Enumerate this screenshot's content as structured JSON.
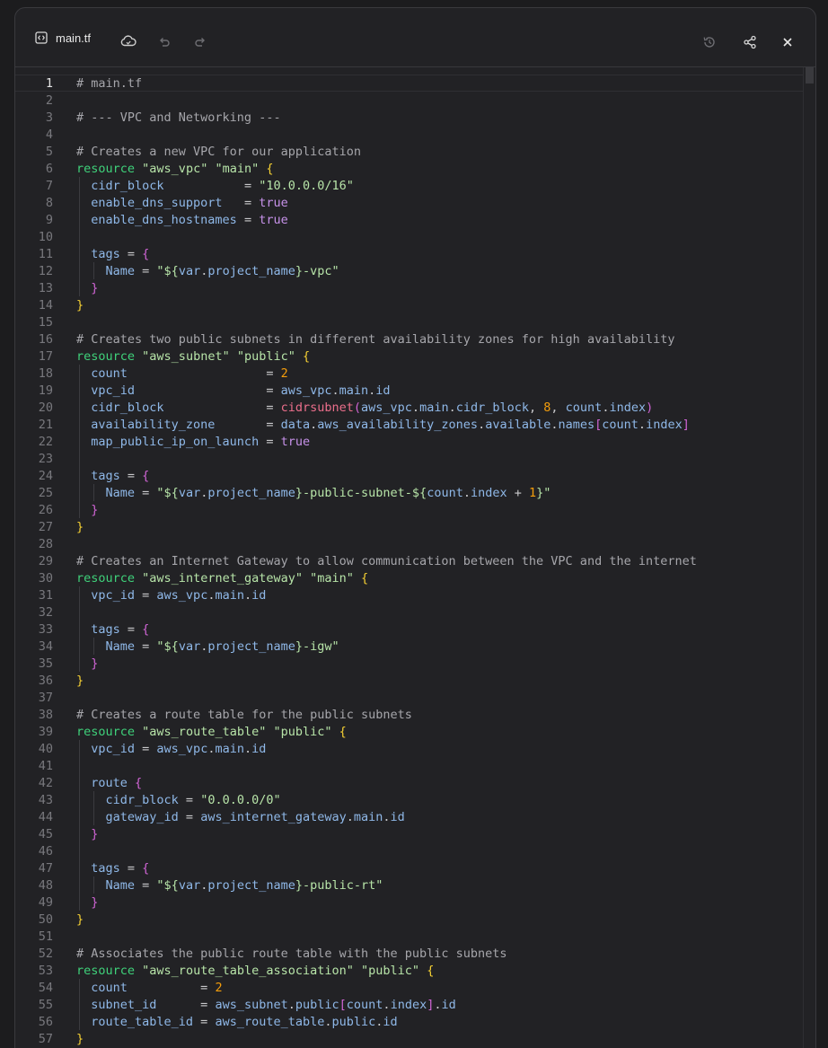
{
  "tab": {
    "label": "main.tf",
    "icon": "code-file-icon"
  },
  "toolbar": {
    "icons": [
      "cloud-sync-icon",
      "undo-icon",
      "redo-icon",
      "history-icon",
      "share-icon",
      "close-icon"
    ]
  },
  "editor": {
    "active_line": 1,
    "lines": [
      [
        [
          "# main.tf",
          "cmt"
        ]
      ],
      [],
      [
        [
          "# --- VPC and Networking ---",
          "cmt"
        ]
      ],
      [],
      [
        [
          "# Creates a new VPC for our application",
          "cmt"
        ]
      ],
      [
        [
          "resource",
          "kw"
        ],
        [
          " ",
          "plain"
        ],
        [
          "\"aws_vpc\"",
          "str"
        ],
        [
          " ",
          "plain"
        ],
        [
          "\"main\"",
          "str"
        ],
        [
          " ",
          "plain"
        ],
        [
          "{",
          "br1"
        ]
      ],
      [
        [
          "  cidr_block",
          "attr"
        ],
        [
          "           = ",
          "plain"
        ],
        [
          "\"10.0.0.0/16\"",
          "str"
        ]
      ],
      [
        [
          "  enable_dns_support",
          "attr"
        ],
        [
          "   = ",
          "plain"
        ],
        [
          "true",
          "bool"
        ]
      ],
      [
        [
          "  enable_dns_hostnames",
          "attr"
        ],
        [
          " = ",
          "plain"
        ],
        [
          "true",
          "bool"
        ]
      ],
      [],
      [
        [
          "  tags",
          "attr"
        ],
        [
          " = ",
          "plain"
        ],
        [
          "{",
          "br2"
        ]
      ],
      [
        [
          "    Name",
          "attr"
        ],
        [
          " = ",
          "plain"
        ],
        [
          "\"${",
          "str"
        ],
        [
          "var",
          "var"
        ],
        [
          ".",
          "plain"
        ],
        [
          "project_name",
          "var"
        ],
        [
          "}-vpc\"",
          "str"
        ]
      ],
      [
        [
          "  }",
          "br2"
        ]
      ],
      [
        [
          "}",
          "br1"
        ]
      ],
      [],
      [
        [
          "# Creates two public subnets in different availability zones for high availability",
          "cmt"
        ]
      ],
      [
        [
          "resource",
          "kw"
        ],
        [
          " ",
          "plain"
        ],
        [
          "\"aws_subnet\"",
          "str"
        ],
        [
          " ",
          "plain"
        ],
        [
          "\"public\"",
          "str"
        ],
        [
          " ",
          "plain"
        ],
        [
          "{",
          "br1"
        ]
      ],
      [
        [
          "  count",
          "attr"
        ],
        [
          "                   = ",
          "plain"
        ],
        [
          "2",
          "num"
        ]
      ],
      [
        [
          "  vpc_id",
          "attr"
        ],
        [
          "                  = ",
          "plain"
        ],
        [
          "aws_vpc",
          "var"
        ],
        [
          ".",
          "plain"
        ],
        [
          "main",
          "var"
        ],
        [
          ".",
          "plain"
        ],
        [
          "id",
          "var"
        ]
      ],
      [
        [
          "  cidr_block",
          "attr"
        ],
        [
          "              = ",
          "plain"
        ],
        [
          "cidrsubnet",
          "fn"
        ],
        [
          "(",
          "br2"
        ],
        [
          "aws_vpc",
          "var"
        ],
        [
          ".",
          "plain"
        ],
        [
          "main",
          "var"
        ],
        [
          ".",
          "plain"
        ],
        [
          "cidr_block",
          "var"
        ],
        [
          ", ",
          "plain"
        ],
        [
          "8",
          "num"
        ],
        [
          ", ",
          "plain"
        ],
        [
          "count",
          "var"
        ],
        [
          ".",
          "plain"
        ],
        [
          "index",
          "var"
        ],
        [
          ")",
          "br2"
        ]
      ],
      [
        [
          "  availability_zone",
          "attr"
        ],
        [
          "       = ",
          "plain"
        ],
        [
          "data",
          "var"
        ],
        [
          ".",
          "plain"
        ],
        [
          "aws_availability_zones",
          "var"
        ],
        [
          ".",
          "plain"
        ],
        [
          "available",
          "var"
        ],
        [
          ".",
          "plain"
        ],
        [
          "names",
          "var"
        ],
        [
          "[",
          "br2"
        ],
        [
          "count",
          "var"
        ],
        [
          ".",
          "plain"
        ],
        [
          "index",
          "var"
        ],
        [
          "]",
          "br2"
        ]
      ],
      [
        [
          "  map_public_ip_on_launch",
          "attr"
        ],
        [
          " = ",
          "plain"
        ],
        [
          "true",
          "bool"
        ]
      ],
      [],
      [
        [
          "  tags",
          "attr"
        ],
        [
          " = ",
          "plain"
        ],
        [
          "{",
          "br2"
        ]
      ],
      [
        [
          "    Name",
          "attr"
        ],
        [
          " = ",
          "plain"
        ],
        [
          "\"${",
          "str"
        ],
        [
          "var",
          "var"
        ],
        [
          ".",
          "plain"
        ],
        [
          "project_name",
          "var"
        ],
        [
          "}-public-subnet-${",
          "str"
        ],
        [
          "count",
          "var"
        ],
        [
          ".",
          "plain"
        ],
        [
          "index",
          "var"
        ],
        [
          " + ",
          "plain"
        ],
        [
          "1",
          "num"
        ],
        [
          "}\"",
          "str"
        ]
      ],
      [
        [
          "  }",
          "br2"
        ]
      ],
      [
        [
          "}",
          "br1"
        ]
      ],
      [],
      [
        [
          "# Creates an Internet Gateway to allow communication between the VPC and the internet",
          "cmt"
        ]
      ],
      [
        [
          "resource",
          "kw"
        ],
        [
          " ",
          "plain"
        ],
        [
          "\"aws_internet_gateway\"",
          "str"
        ],
        [
          " ",
          "plain"
        ],
        [
          "\"main\"",
          "str"
        ],
        [
          " ",
          "plain"
        ],
        [
          "{",
          "br1"
        ]
      ],
      [
        [
          "  vpc_id",
          "attr"
        ],
        [
          " = ",
          "plain"
        ],
        [
          "aws_vpc",
          "var"
        ],
        [
          ".",
          "plain"
        ],
        [
          "main",
          "var"
        ],
        [
          ".",
          "plain"
        ],
        [
          "id",
          "var"
        ]
      ],
      [],
      [
        [
          "  tags",
          "attr"
        ],
        [
          " = ",
          "plain"
        ],
        [
          "{",
          "br2"
        ]
      ],
      [
        [
          "    Name",
          "attr"
        ],
        [
          " = ",
          "plain"
        ],
        [
          "\"${",
          "str"
        ],
        [
          "var",
          "var"
        ],
        [
          ".",
          "plain"
        ],
        [
          "project_name",
          "var"
        ],
        [
          "}-igw\"",
          "str"
        ]
      ],
      [
        [
          "  }",
          "br2"
        ]
      ],
      [
        [
          "}",
          "br1"
        ]
      ],
      [],
      [
        [
          "# Creates a route table for the public subnets",
          "cmt"
        ]
      ],
      [
        [
          "resource",
          "kw"
        ],
        [
          " ",
          "plain"
        ],
        [
          "\"aws_route_table\"",
          "str"
        ],
        [
          " ",
          "plain"
        ],
        [
          "\"public\"",
          "str"
        ],
        [
          " ",
          "plain"
        ],
        [
          "{",
          "br1"
        ]
      ],
      [
        [
          "  vpc_id",
          "attr"
        ],
        [
          " = ",
          "plain"
        ],
        [
          "aws_vpc",
          "var"
        ],
        [
          ".",
          "plain"
        ],
        [
          "main",
          "var"
        ],
        [
          ".",
          "plain"
        ],
        [
          "id",
          "var"
        ]
      ],
      [],
      [
        [
          "  route",
          "attr"
        ],
        [
          " ",
          "plain"
        ],
        [
          "{",
          "br2"
        ]
      ],
      [
        [
          "    cidr_block",
          "attr"
        ],
        [
          " = ",
          "plain"
        ],
        [
          "\"0.0.0.0/0\"",
          "str"
        ]
      ],
      [
        [
          "    gateway_id",
          "attr"
        ],
        [
          " = ",
          "plain"
        ],
        [
          "aws_internet_gateway",
          "var"
        ],
        [
          ".",
          "plain"
        ],
        [
          "main",
          "var"
        ],
        [
          ".",
          "plain"
        ],
        [
          "id",
          "var"
        ]
      ],
      [
        [
          "  }",
          "br2"
        ]
      ],
      [],
      [
        [
          "  tags",
          "attr"
        ],
        [
          " = ",
          "plain"
        ],
        [
          "{",
          "br2"
        ]
      ],
      [
        [
          "    Name",
          "attr"
        ],
        [
          " = ",
          "plain"
        ],
        [
          "\"${",
          "str"
        ],
        [
          "var",
          "var"
        ],
        [
          ".",
          "plain"
        ],
        [
          "project_name",
          "var"
        ],
        [
          "}-public-rt\"",
          "str"
        ]
      ],
      [
        [
          "  }",
          "br2"
        ]
      ],
      [
        [
          "}",
          "br1"
        ]
      ],
      [],
      [
        [
          "# Associates the public route table with the public subnets",
          "cmt"
        ]
      ],
      [
        [
          "resource",
          "kw"
        ],
        [
          " ",
          "plain"
        ],
        [
          "\"aws_route_table_association\"",
          "str"
        ],
        [
          " ",
          "plain"
        ],
        [
          "\"public\"",
          "str"
        ],
        [
          " ",
          "plain"
        ],
        [
          "{",
          "br1"
        ]
      ],
      [
        [
          "  count",
          "attr"
        ],
        [
          "          = ",
          "plain"
        ],
        [
          "2",
          "num"
        ]
      ],
      [
        [
          "  subnet_id",
          "attr"
        ],
        [
          "      = ",
          "plain"
        ],
        [
          "aws_subnet",
          "var"
        ],
        [
          ".",
          "plain"
        ],
        [
          "public",
          "var"
        ],
        [
          "[",
          "br2"
        ],
        [
          "count",
          "var"
        ],
        [
          ".",
          "plain"
        ],
        [
          "index",
          "var"
        ],
        [
          "]",
          "br2"
        ],
        [
          ".",
          "plain"
        ],
        [
          "id",
          "var"
        ]
      ],
      [
        [
          "  route_table_id",
          "attr"
        ],
        [
          " = ",
          "plain"
        ],
        [
          "aws_route_table",
          "var"
        ],
        [
          ".",
          "plain"
        ],
        [
          "public",
          "var"
        ],
        [
          ".",
          "plain"
        ],
        [
          "id",
          "var"
        ]
      ],
      [
        [
          "}",
          "br1"
        ]
      ],
      []
    ]
  }
}
